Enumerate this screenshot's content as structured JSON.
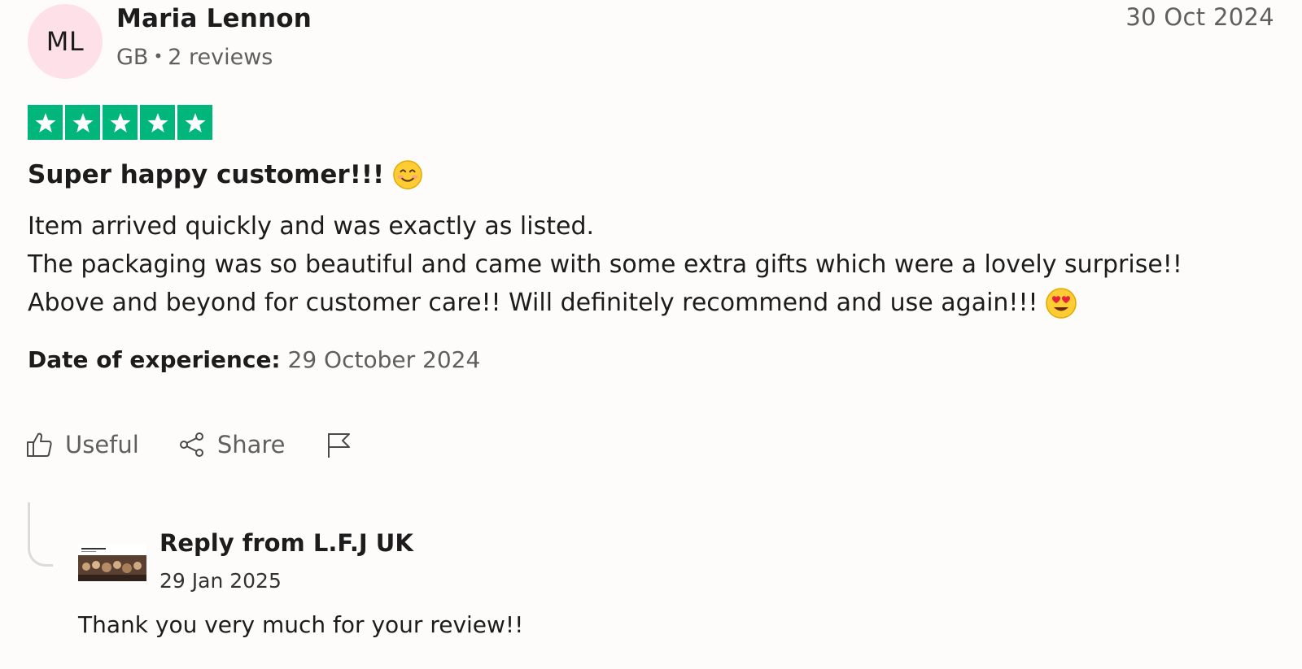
{
  "reviewer": {
    "initials": "ML",
    "name": "Maria Lennon",
    "country": "GB",
    "reviews_count": "2 reviews"
  },
  "review": {
    "date": "30 Oct 2024",
    "rating": 5,
    "rating_max": 5,
    "star_color": "#00b67a",
    "title": "Super happy customer!!!",
    "title_emoji": "smiling-face-emoji",
    "body_lines": [
      "Item arrived quickly and was exactly as listed.",
      "The packaging was so beautiful and came with some extra gifts which were a lovely surprise!!",
      "Above and beyond for customer care!! Will definitely recommend and use again!!!"
    ],
    "body_emoji": "heart-eyes-emoji",
    "experience_label": "Date of experience:",
    "experience_date": "29 October 2024"
  },
  "actions": {
    "useful_label": "Useful",
    "share_label": "Share",
    "report_icon": "flag-icon"
  },
  "reply": {
    "from_label": "Reply from L.F.J UK",
    "date": "29 Jan 2025",
    "text": "Thank you very much for your review!!"
  }
}
